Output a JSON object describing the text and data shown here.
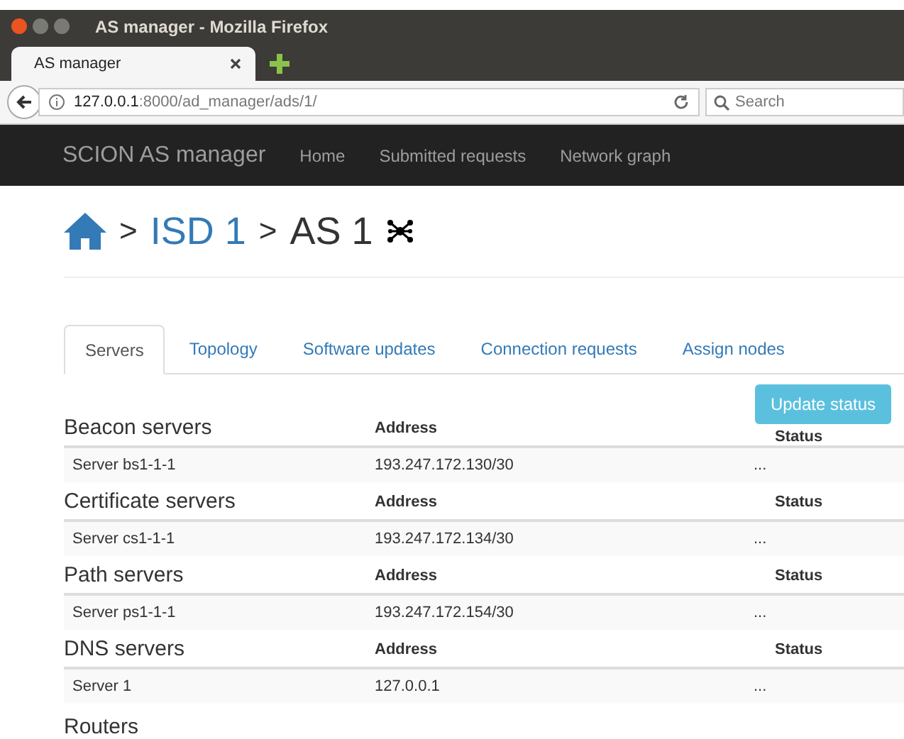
{
  "window": {
    "title": "AS manager - Mozilla Firefox"
  },
  "browser_tabs": [
    {
      "label": "AS manager",
      "selected": true
    }
  ],
  "address_bar": {
    "host": "127.0.0.1",
    "path": ":8000/ad_manager/ads/1/"
  },
  "search": {
    "placeholder": "Search"
  },
  "navbar": {
    "brand": "SCION AS manager",
    "links": [
      "Home",
      "Submitted requests",
      "Network graph"
    ]
  },
  "breadcrumb": {
    "separator_1": ">",
    "isd": "ISD 1",
    "separator_2": ">",
    "as": "AS 1"
  },
  "tabs": [
    {
      "label": "Servers",
      "selected": true
    },
    {
      "label": "Topology",
      "selected": false
    },
    {
      "label": "Software updates",
      "selected": false
    },
    {
      "label": "Connection requests",
      "selected": false
    },
    {
      "label": "Assign nodes",
      "selected": false
    }
  ],
  "update_button": "Update status",
  "sections": [
    {
      "title": "Beacon servers",
      "address_header": "Address",
      "status_header": "Status",
      "rows": [
        {
          "name": "Server bs1-1-1",
          "address": "193.247.172.130/30",
          "status": "..."
        }
      ]
    },
    {
      "title": "Certificate servers",
      "address_header": "Address",
      "status_header": "Status",
      "rows": [
        {
          "name": "Server cs1-1-1",
          "address": "193.247.172.134/30",
          "status": "..."
        }
      ]
    },
    {
      "title": "Path servers",
      "address_header": "Address",
      "status_header": "Status",
      "rows": [
        {
          "name": "Server ps1-1-1",
          "address": "193.247.172.154/30",
          "status": "..."
        }
      ]
    },
    {
      "title": "DNS servers",
      "address_header": "Address",
      "status_header": "Status",
      "rows": [
        {
          "name": "Server 1",
          "address": "127.0.0.1",
          "status": "..."
        }
      ]
    },
    {
      "title": "Routers"
    }
  ]
}
